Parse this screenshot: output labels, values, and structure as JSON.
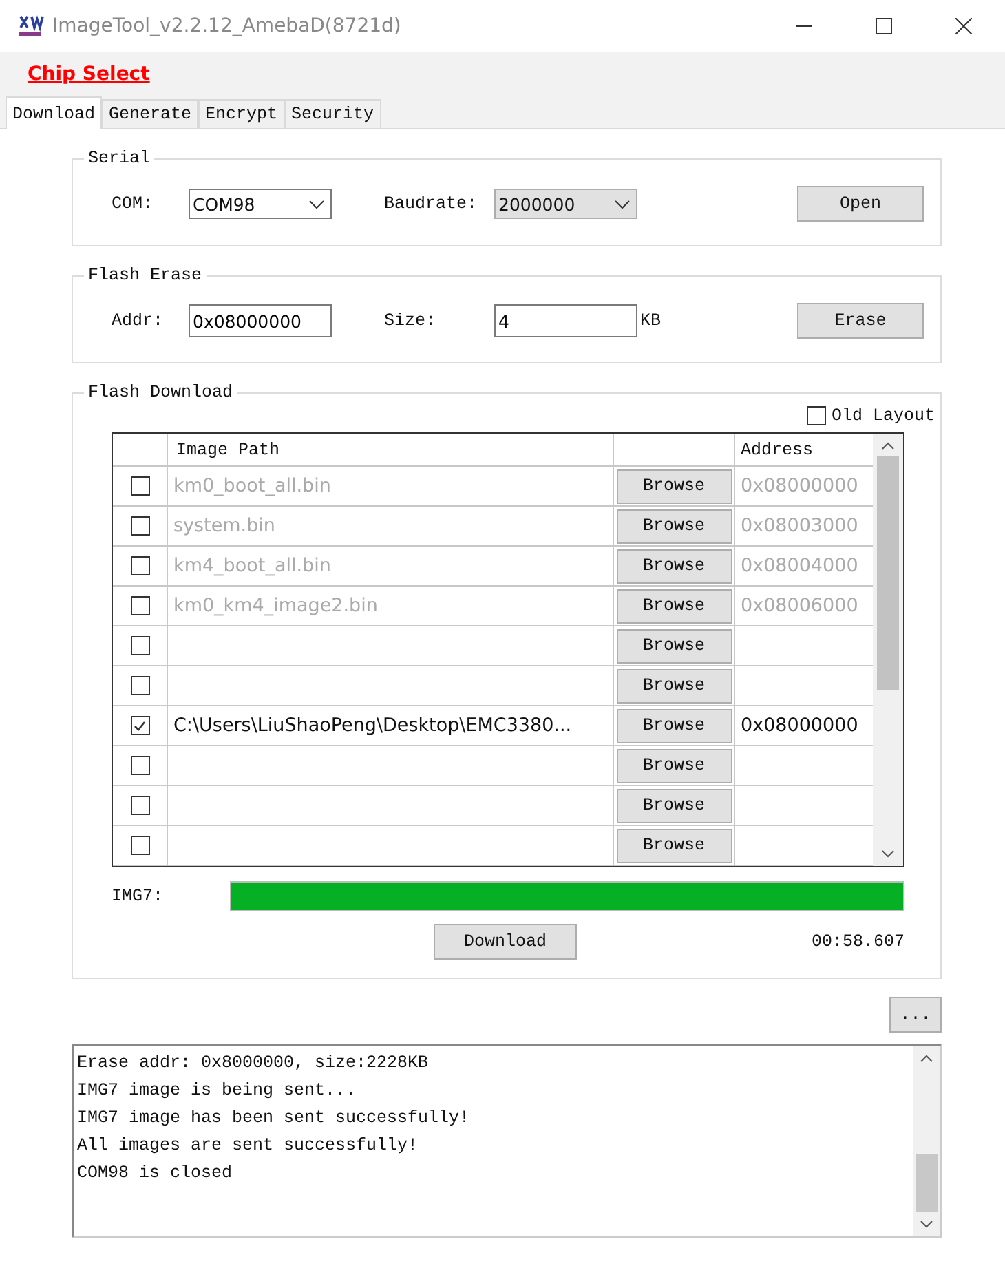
{
  "window": {
    "title": "ImageTool_v2.2.12_AmebaD(8721d)"
  },
  "chip_select": "Chip Select",
  "tabs": [
    {
      "label": "Download",
      "selected": true
    },
    {
      "label": "Generate",
      "selected": false
    },
    {
      "label": "Encrypt",
      "selected": false
    },
    {
      "label": "Security",
      "selected": false
    }
  ],
  "serial": {
    "title": "Serial",
    "com_label": "COM:",
    "com_value": "COM98",
    "baud_label": "Baudrate:",
    "baud_value": "2000000",
    "open_button": "Open"
  },
  "flash_erase": {
    "title": "Flash Erase",
    "addr_label": "Addr:",
    "addr_value": "0x08000000",
    "size_label": "Size:",
    "size_value": "4",
    "size_unit": "KB",
    "erase_button": "Erase"
  },
  "flash_download": {
    "title": "Flash Download",
    "old_layout": {
      "label": "Old Layout",
      "checked": false
    },
    "table": {
      "columns": [
        "Image Path",
        "Address"
      ],
      "rows": [
        {
          "checked": false,
          "path": "km0_boot_all.bin",
          "button": "Browse",
          "address": "0x08000000"
        },
        {
          "checked": false,
          "path": "system.bin",
          "button": "Browse",
          "address": "0x08003000"
        },
        {
          "checked": false,
          "path": "km4_boot_all.bin",
          "button": "Browse",
          "address": "0x08004000"
        },
        {
          "checked": false,
          "path": "km0_km4_image2.bin",
          "button": "Browse",
          "address": "0x08006000"
        },
        {
          "checked": false,
          "button": "Browse"
        },
        {
          "checked": false,
          "button": "Browse"
        },
        {
          "checked": true,
          "path": "C:\\Users\\LiuShaoPeng\\Desktop\\EMC3380...",
          "button": "Browse",
          "address": "0x08000000"
        },
        {
          "checked": false,
          "button": "Browse"
        },
        {
          "checked": false,
          "button": "Browse"
        },
        {
          "checked": false,
          "button": "Browse"
        }
      ]
    },
    "progress": {
      "label": "IMG7:",
      "level": 1
    },
    "download_button": "Download",
    "elapsed": "00:58.607"
  },
  "more_button": "...",
  "log": [
    "Erase addr: 0x8000000, size:2228KB",
    "IMG7 image is being sent...",
    "IMG7 image has been sent successfully!",
    "All images are sent successfully!",
    "COM98 is closed"
  ]
}
